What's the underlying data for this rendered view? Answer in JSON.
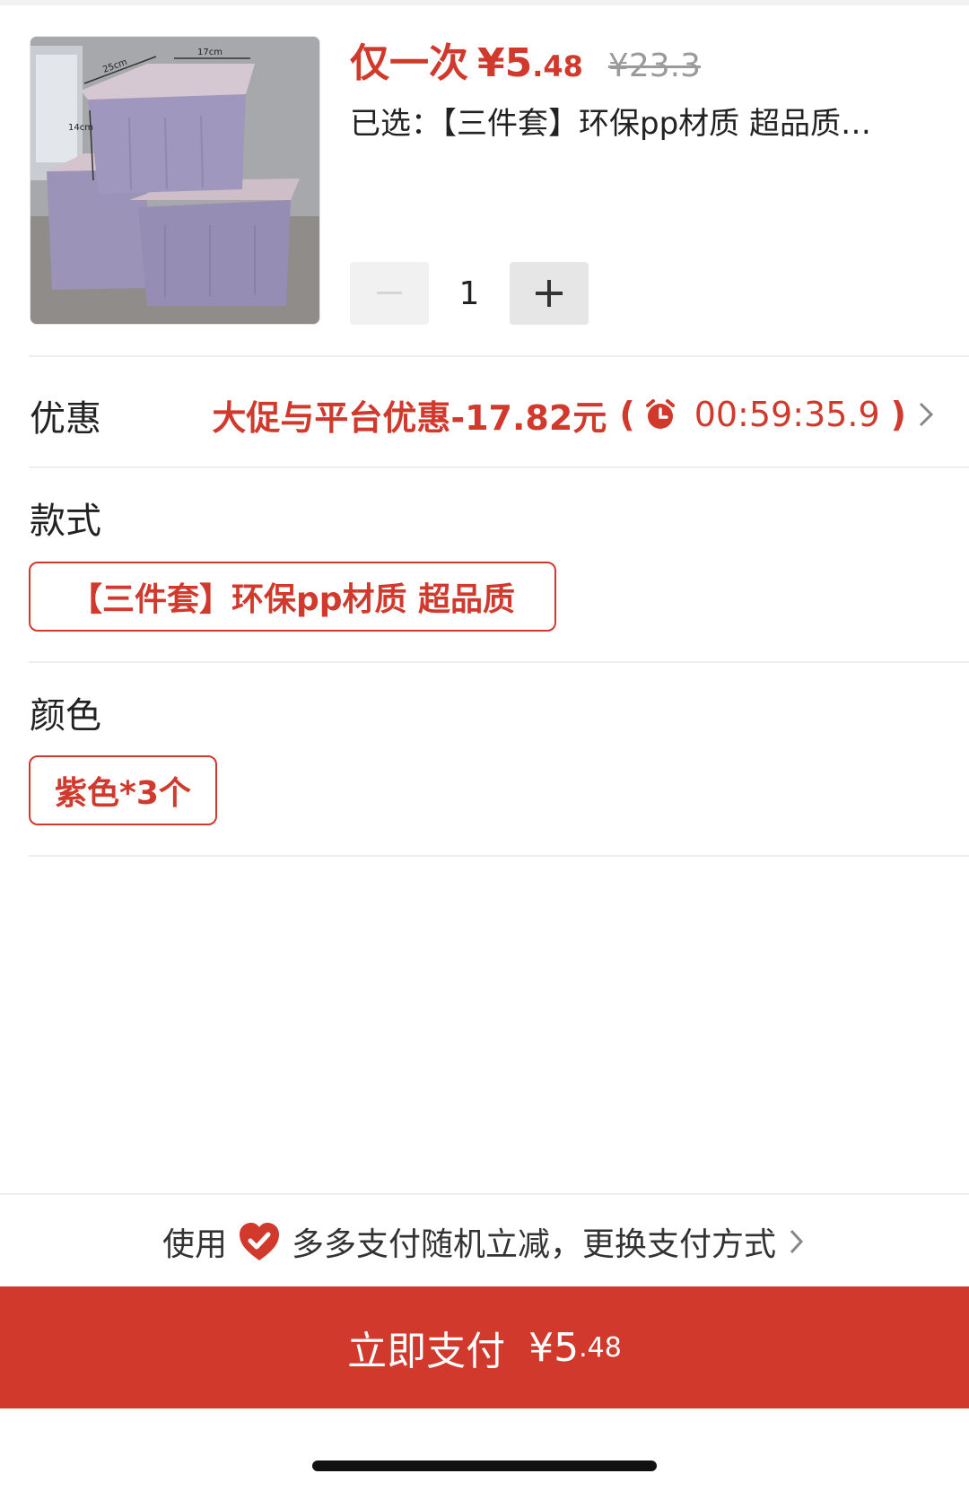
{
  "product": {
    "price_prefix": "仅一次",
    "price_main": "¥5",
    "price_cents": ".48",
    "original_price": "¥23.3",
    "selected_text": "已选：【三件套】环保pp材质 超品质…",
    "quantity": "1",
    "thumbnail_dims": {
      "w": "25cm",
      "l": "17cm",
      "h": "14cm"
    }
  },
  "discount": {
    "label": "优惠",
    "text": "大促与平台优惠-17.82元",
    "open_paren": "(",
    "timer": "00:59:35.9",
    "close_paren": ")"
  },
  "style": {
    "label": "款式",
    "selected_option": "【三件套】环保pp材质 超品质"
  },
  "color": {
    "label": "颜色",
    "selected_option": "紫色*3个"
  },
  "payment": {
    "hint_prefix": "使用",
    "hint_suffix": "多多支付随机立减，更换支付方式",
    "button_label": "立即支付",
    "button_amount": "¥5",
    "button_cents": ".48"
  },
  "colors": {
    "accent": "#d0392b",
    "product_purple": "#9b93b8",
    "lid_pink": "#cdbec8"
  },
  "icons": [
    "minus-icon",
    "plus-icon",
    "alarm-clock-icon",
    "chevron-right-icon",
    "pay-shield-icon"
  ]
}
